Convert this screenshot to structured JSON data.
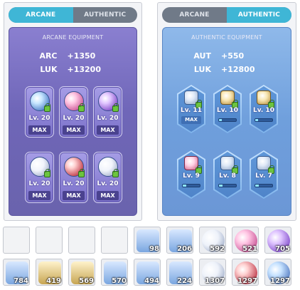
{
  "arcane_window": {
    "tabs": [
      {
        "label": "ARCANE",
        "active": true
      },
      {
        "label": "AUTHENTIC",
        "active": false
      }
    ],
    "title": "ARCANE EQUIPMENT",
    "stats": [
      {
        "key": "ARC",
        "value": "+1350"
      },
      {
        "key": "LUK",
        "value": "+13200"
      }
    ],
    "cards": [
      {
        "icon": "vanishing-journey-arcane-symbol-icon",
        "level": "Lv. 20",
        "badge": "MAX"
      },
      {
        "icon": "chu-chu-arcane-symbol-icon",
        "level": "Lv. 20",
        "badge": "MAX"
      },
      {
        "icon": "lachelein-arcane-symbol-icon",
        "level": "Lv. 20",
        "badge": "MAX"
      },
      {
        "icon": "arcana-arcane-symbol-icon",
        "level": "Lv. 20",
        "badge": "MAX"
      },
      {
        "icon": "morass-arcane-symbol-icon",
        "level": "Lv. 20",
        "badge": "MAX"
      },
      {
        "icon": "esfera-arcane-symbol-icon",
        "level": "Lv. 20",
        "badge": "MAX"
      }
    ]
  },
  "authentic_window": {
    "tabs": [
      {
        "label": "ARCANE",
        "active": false
      },
      {
        "label": "AUTHENTIC",
        "active": true
      }
    ],
    "title": "AUTHENTIC EQUIPMENT",
    "stats": [
      {
        "key": "AUT",
        "value": "+550"
      },
      {
        "key": "LUK",
        "value": "+12800"
      }
    ],
    "cards": [
      {
        "icon": "cernium-authentic-symbol-icon",
        "level": "Lv. 11",
        "badge": "MAX",
        "progress": 1.0
      },
      {
        "icon": "arcus-authentic-symbol-icon",
        "level": "Lv. 10",
        "badge": "",
        "progress": 0.15
      },
      {
        "icon": "odium-authentic-symbol-icon",
        "level": "Lv. 10",
        "badge": "",
        "progress": 0.15
      },
      {
        "icon": "shangri-la-authentic-symbol-icon",
        "level": "Lv. 9",
        "badge": "",
        "progress": 0.2
      },
      {
        "icon": "arteria-authentic-symbol-icon",
        "level": "Lv. 8",
        "badge": "",
        "progress": 0.2
      },
      {
        "icon": "carcion-authentic-symbol-icon",
        "level": "Lv. 7",
        "badge": "",
        "progress": 0.2
      }
    ]
  },
  "inventory": {
    "row1": [
      {
        "icon": "",
        "qty": ""
      },
      {
        "icon": "",
        "qty": ""
      },
      {
        "icon": "",
        "qty": ""
      },
      {
        "icon": "",
        "qty": ""
      },
      {
        "icon": "authentic-symbol-icon",
        "qty": "98"
      },
      {
        "icon": "authentic-symbol-icon",
        "qty": "206"
      },
      {
        "icon": "arcane-symbol-icon",
        "qty": "592"
      },
      {
        "icon": "arcane-symbol-icon",
        "qty": "521"
      },
      {
        "icon": "arcane-symbol-icon",
        "qty": "705"
      }
    ],
    "row2": [
      {
        "icon": "authentic-symbol-icon",
        "qty": "784"
      },
      {
        "icon": "authentic-symbol-icon",
        "qty": "419"
      },
      {
        "icon": "authentic-symbol-icon",
        "qty": "569"
      },
      {
        "icon": "authentic-symbol-icon",
        "qty": "570"
      },
      {
        "icon": "authentic-symbol-icon",
        "qty": "494"
      },
      {
        "icon": "authentic-symbol-icon",
        "qty": "224"
      },
      {
        "icon": "arcane-symbol-icon",
        "qty": "1307"
      },
      {
        "icon": "arcane-symbol-icon",
        "qty": "1297"
      },
      {
        "icon": "arcane-symbol-icon",
        "qty": "1297"
      }
    ]
  },
  "colors": {
    "active_tab": "#3fb6d6",
    "arcane_panel": "#6f66b8",
    "authentic_panel": "#6f9fdc"
  }
}
